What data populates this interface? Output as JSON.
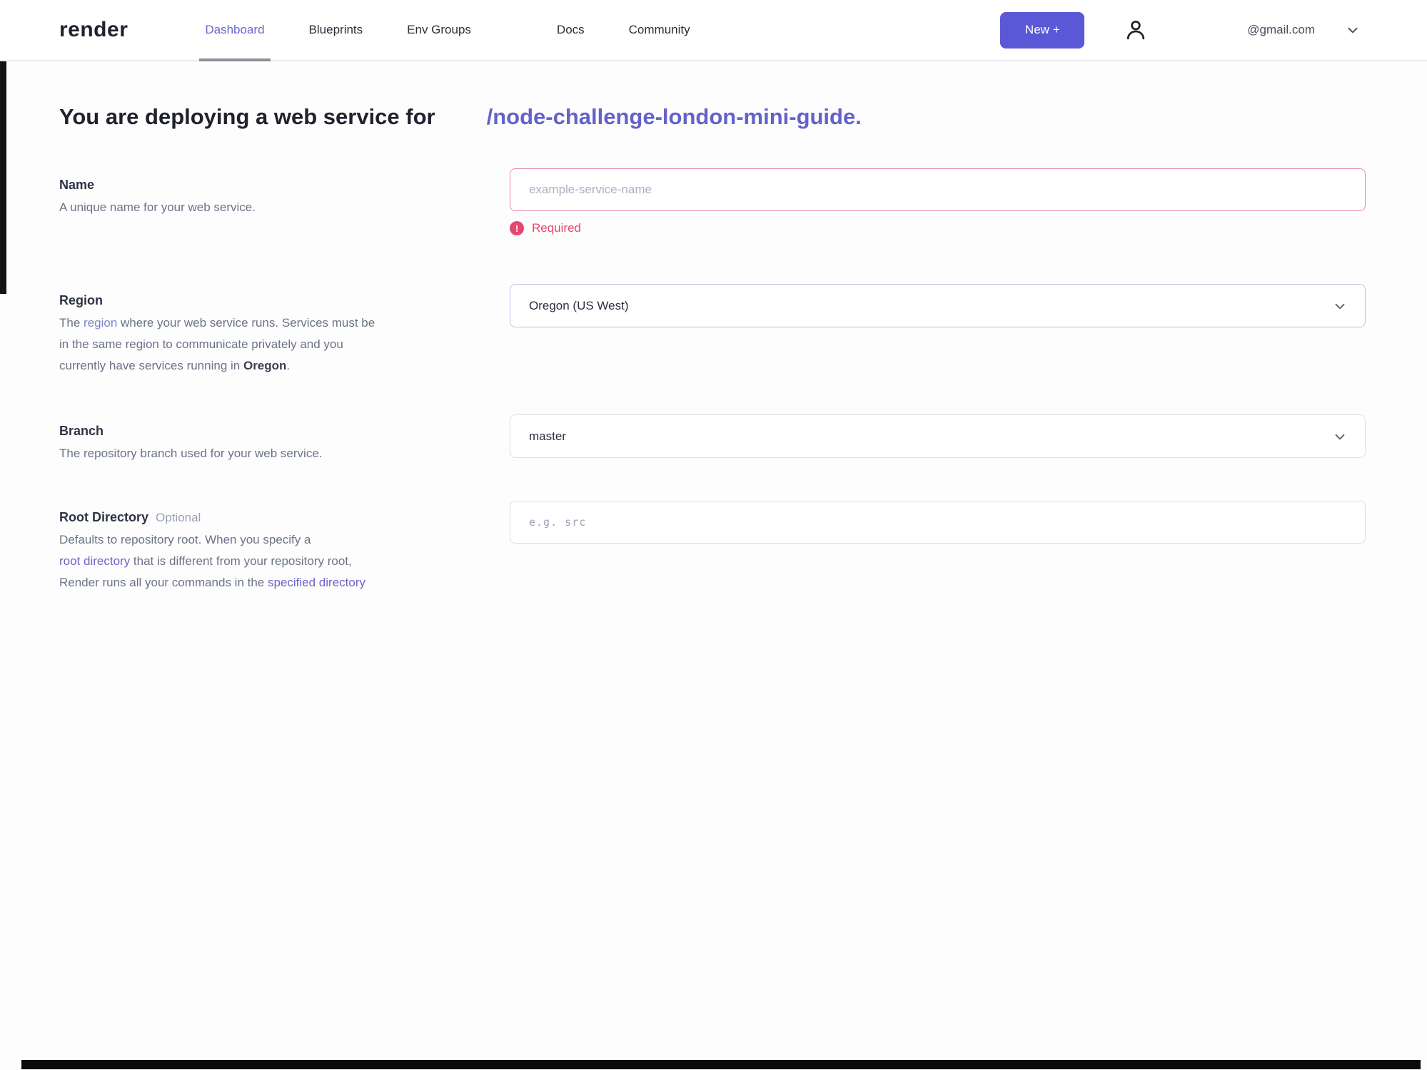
{
  "nav": {
    "logo": "render",
    "items": [
      {
        "label": "Dashboard"
      },
      {
        "label": "Blueprints"
      },
      {
        "label": "Env Groups"
      },
      {
        "label": "Docs"
      },
      {
        "label": "Community"
      }
    ],
    "new_button_label": "New +",
    "account_email": "@gmail.com"
  },
  "heading": {
    "prefix": "You are deploying a web service for",
    "repo": "/node-challenge-london-mini-guide."
  },
  "form": {
    "name": {
      "label": "Name",
      "description": "A unique name for your web service.",
      "placeholder": "example-service-name",
      "value": "",
      "error": "Required",
      "error_icon_glyph": "!"
    },
    "region": {
      "label": "Region",
      "value": "Oregon (US West)",
      "desc_l1a": "The ",
      "desc_l1_link": "region",
      "desc_l1b": " where your web service runs. Services must be",
      "desc_l2": "in the same region to communicate privately and you",
      "desc_l3a": "currently have services running in ",
      "desc_l3_strong": "Oregon",
      "desc_l3b": "."
    },
    "branch": {
      "label": "Branch",
      "description": "The repository branch used for your web service.",
      "value": "master"
    },
    "root_directory": {
      "label": "Root Directory",
      "optional_tag": "Optional",
      "placeholder": "e.g. src",
      "value": "",
      "desc_l1": "Defaults to repository root. When you specify a",
      "desc_l2_link": "root directory",
      "desc_l2b": " that is different from your repository root,",
      "desc_l3a": "Render runs all your commands in the ",
      "desc_l3_link": "specified directory"
    }
  },
  "colors": {
    "accent_purple": "#6462c9",
    "new_button": "#5a58d6",
    "error_pink": "#e5476f",
    "name_input_border": "#e88aa0",
    "region_border": "#b9c2ee",
    "active_nav": "#6b68c9",
    "tab_indicator": "#8f8f99"
  }
}
